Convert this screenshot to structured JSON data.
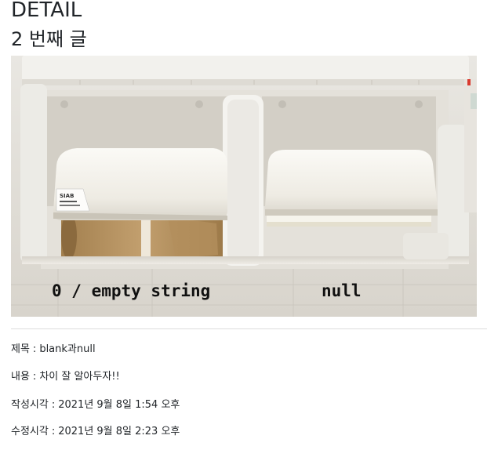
{
  "heading": "DETAIL",
  "subtitle": "2 번째 글",
  "image": {
    "caption_left": "0 / empty string",
    "caption_right": "null",
    "label_brand": "SIAB"
  },
  "fields": [
    {
      "label": "제목",
      "value": "blank과null"
    },
    {
      "label": "내용",
      "value": "차이 잘 알아두자!!"
    },
    {
      "label": "작성시각",
      "value": "2021년 9월 8일 1:54 오후"
    },
    {
      "label": "수정시각",
      "value": "2021년 9월 8일 2:23 오후"
    }
  ],
  "separator": ":"
}
